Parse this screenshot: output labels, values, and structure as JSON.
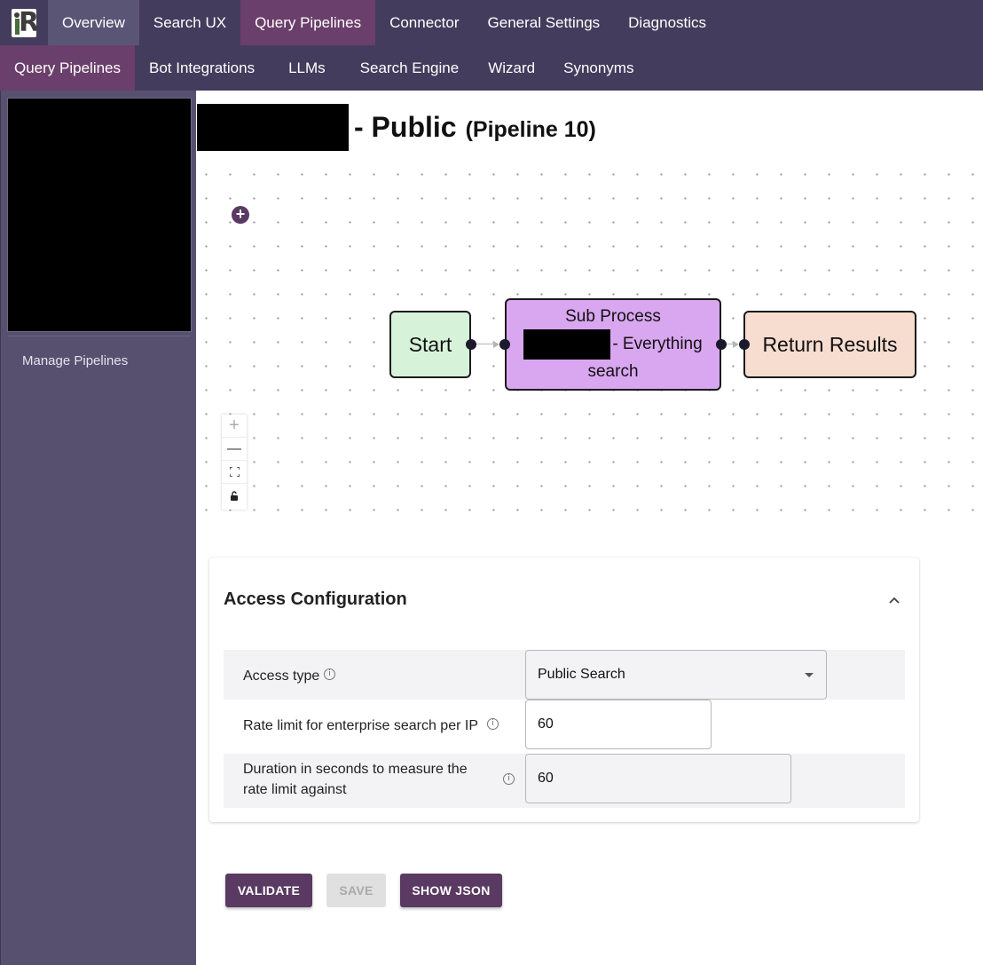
{
  "topnav": {
    "tabs": [
      "Overview",
      "Search UX",
      "Query Pipelines",
      "Connector",
      "General Settings",
      "Diagnostics"
    ]
  },
  "subnav": {
    "tabs": [
      "Query Pipelines",
      "Bot Integrations",
      "LLMs",
      "Search Engine",
      "Wizard",
      "Synonyms"
    ]
  },
  "sidebar": {
    "manage_link": "Manage Pipelines"
  },
  "header": {
    "title": "- Public",
    "subtitle": "(Pipeline 10)"
  },
  "flow": {
    "add_symbol": "+",
    "nodes": {
      "start": "Start",
      "sub_line1": "Sub Process",
      "sub_line2": "- Everything",
      "sub_line3": "search",
      "return": "Return Results"
    },
    "controls": {
      "zoom_in": "+",
      "zoom_out": "—",
      "fit": "⛶",
      "lock": "🔓"
    }
  },
  "access": {
    "title": "Access Configuration",
    "access_type_label": "Access type",
    "access_type_value": "Public Search",
    "rate_limit_label": "Rate limit for enterprise search per IP",
    "rate_limit_value": "60",
    "duration_label_1": "Duration in seconds to measure the",
    "duration_label_2": "rate limit against",
    "duration_value": "60",
    "info_symbol": "i"
  },
  "buttons": {
    "validate": "VALIDATE",
    "save": "SAVE",
    "show_json": "SHOW JSON"
  }
}
